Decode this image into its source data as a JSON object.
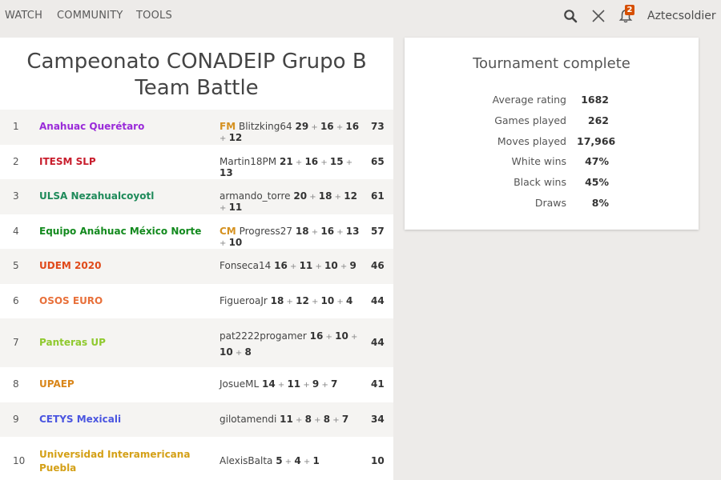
{
  "nav": {
    "items": [
      "WATCH",
      "COMMUNITY",
      "TOOLS"
    ],
    "notification_count": "2",
    "username": "Aztecsoldier"
  },
  "tournament": {
    "title": "Campeonato CONADEIP Grupo B Team Battle"
  },
  "standings": [
    {
      "rank": "1",
      "team": "Anahuac Querétaro",
      "team_color": "#9a2bd9",
      "title": "FM",
      "player": "Blitzking64",
      "scores": [
        "29",
        "16",
        "16",
        "12"
      ],
      "total": "73"
    },
    {
      "rank": "2",
      "team": "ITESM SLP",
      "team_color": "#c81d2c",
      "title": "",
      "player": "Martin18PM",
      "scores": [
        "21",
        "16",
        "15",
        "13"
      ],
      "total": "65"
    },
    {
      "rank": "3",
      "team": "ULSA Nezahualcoyotl",
      "team_color": "#1e8a5a",
      "title": "",
      "player": "armando_torre",
      "scores": [
        "20",
        "18",
        "12",
        "11"
      ],
      "total": "61"
    },
    {
      "rank": "4",
      "team": "Equipo Anáhuac México Norte",
      "team_color": "#138a1e",
      "title": "CM",
      "player": "Progress27",
      "scores": [
        "18",
        "16",
        "13",
        "10"
      ],
      "total": "57"
    },
    {
      "rank": "5",
      "team": "UDEM 2020",
      "team_color": "#e04a1a",
      "title": "",
      "player": "Fonseca14",
      "scores": [
        "16",
        "11",
        "10",
        "9"
      ],
      "total": "46"
    },
    {
      "rank": "6",
      "team": "OSOS EURO",
      "team_color": "#e8703a",
      "title": "",
      "player": "FigueroaJr",
      "scores": [
        "18",
        "12",
        "10",
        "4"
      ],
      "total": "44"
    },
    {
      "rank": "7",
      "team": "Panteras UP",
      "team_color": "#8fc92e",
      "title": "",
      "player": "pat2222progamer",
      "scores": [
        "16",
        "10",
        "10",
        "8"
      ],
      "total": "44"
    },
    {
      "rank": "8",
      "team": "UPAEP",
      "team_color": "#d9861a",
      "title": "",
      "player": "JosueML",
      "scores": [
        "14",
        "11",
        "9",
        "7"
      ],
      "total": "41"
    },
    {
      "rank": "9",
      "team": "CETYS Mexicali",
      "team_color": "#4a55e0",
      "title": "",
      "player": "gilotamendi",
      "scores": [
        "11",
        "8",
        "8",
        "7"
      ],
      "total": "34"
    },
    {
      "rank": "10",
      "team": "Universidad Interamericana Puebla",
      "team_color": "#d4a017",
      "title": "",
      "player": "AlexisBalta",
      "scores": [
        "5",
        "4",
        "1"
      ],
      "total": "10"
    }
  ],
  "stats": {
    "title": "Tournament complete",
    "rows": [
      {
        "label": "Average rating",
        "value": "1682"
      },
      {
        "label": "Games played",
        "value": "262"
      },
      {
        "label": "Moves played",
        "value": "17,966"
      },
      {
        "label": "White wins",
        "value": "47%"
      },
      {
        "label": "Black wins",
        "value": "45%"
      },
      {
        "label": "Draws",
        "value": "8%"
      }
    ]
  }
}
